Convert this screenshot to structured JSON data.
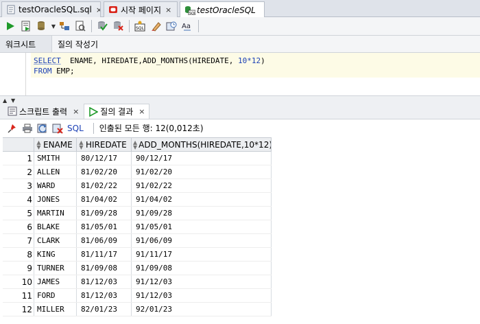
{
  "tabs": [
    {
      "label": "testOracleSQL.sql",
      "icon": "sql-file-icon",
      "close": "×"
    },
    {
      "label": "시작 페이지",
      "icon": "oracle-icon",
      "close": "×"
    },
    {
      "label": "testOracleSQL",
      "icon": "sql-connection-icon",
      "close": ""
    }
  ],
  "subtabs": {
    "worksheet": "워크시트",
    "query_builder": "질의 작성기"
  },
  "editor": {
    "line1": {
      "kw": "SELECT",
      "rest": "  ENAME, HIREDATE,ADD_MONTHS(HIREDATE, ",
      "num": "10*12",
      "end": ")"
    },
    "line2": {
      "kw": "FROM",
      "rest": " EMP;"
    }
  },
  "bottom_tabs": {
    "script_output": "스크립트 출력",
    "query_result": "질의 결과",
    "close": "×"
  },
  "results_toolbar": {
    "sql_label": "SQL",
    "fetched": "인출된 모든 행: 12(0,012초)"
  },
  "columns": [
    "ENAME",
    "HIREDATE",
    "ADD_MONTHS(HIREDATE,10*12)"
  ],
  "rows": [
    {
      "n": "1",
      "ename": "SMITH",
      "hiredate": "80/12/17",
      "add": "90/12/17"
    },
    {
      "n": "2",
      "ename": "ALLEN",
      "hiredate": "81/02/20",
      "add": "91/02/20"
    },
    {
      "n": "3",
      "ename": "WARD",
      "hiredate": "81/02/22",
      "add": "91/02/22"
    },
    {
      "n": "4",
      "ename": "JONES",
      "hiredate": "81/04/02",
      "add": "91/04/02"
    },
    {
      "n": "5",
      "ename": "MARTIN",
      "hiredate": "81/09/28",
      "add": "91/09/28"
    },
    {
      "n": "6",
      "ename": "BLAKE",
      "hiredate": "81/05/01",
      "add": "91/05/01"
    },
    {
      "n": "7",
      "ename": "CLARK",
      "hiredate": "81/06/09",
      "add": "91/06/09"
    },
    {
      "n": "8",
      "ename": "KING",
      "hiredate": "81/11/17",
      "add": "91/11/17"
    },
    {
      "n": "9",
      "ename": "TURNER",
      "hiredate": "81/09/08",
      "add": "91/09/08"
    },
    {
      "n": "10",
      "ename": "JAMES",
      "hiredate": "81/12/03",
      "add": "91/12/03"
    },
    {
      "n": "11",
      "ename": "FORD",
      "hiredate": "81/12/03",
      "add": "91/12/03"
    },
    {
      "n": "12",
      "ename": "MILLER",
      "hiredate": "82/01/23",
      "add": "92/01/23"
    }
  ],
  "colors": {
    "keyword": "#1a3fb5",
    "run_green": "#1f9a2a",
    "oracle_red": "#d9261c"
  }
}
